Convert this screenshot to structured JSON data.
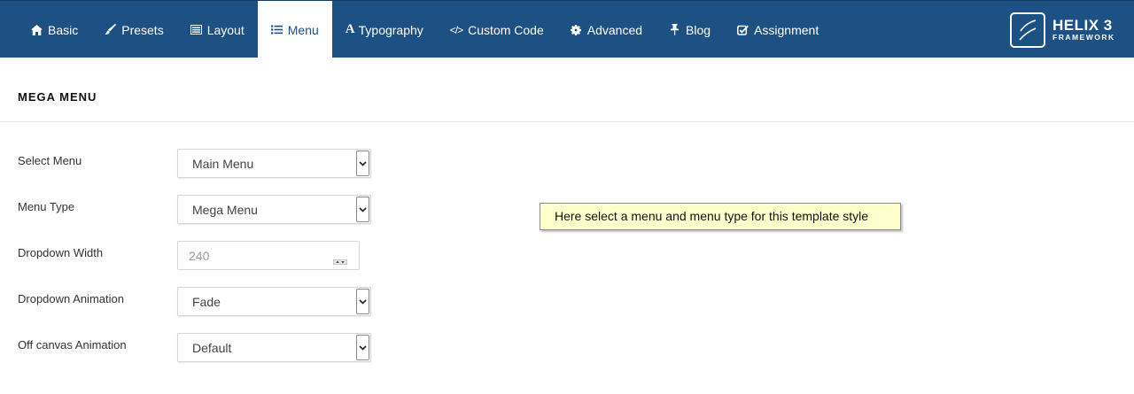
{
  "tabs": [
    {
      "label": "Basic",
      "icon": "home-icon"
    },
    {
      "label": "Presets",
      "icon": "brush-icon"
    },
    {
      "label": "Layout",
      "icon": "layout-icon"
    },
    {
      "label": "Menu",
      "icon": "list-icon",
      "active": true
    },
    {
      "label": "Typography",
      "icon": "font-icon"
    },
    {
      "label": "Custom Code",
      "icon": "code-icon"
    },
    {
      "label": "Advanced",
      "icon": "gear-icon"
    },
    {
      "label": "Blog",
      "icon": "pin-icon"
    },
    {
      "label": "Assignment",
      "icon": "checkbox-icon"
    }
  ],
  "logo": {
    "title": "HELIX 3",
    "subtitle": "FRAMEWORK"
  },
  "section": {
    "title": "MEGA MENU"
  },
  "fields": [
    {
      "label": "Select Menu",
      "value": "Main Menu"
    },
    {
      "label": "Menu Type",
      "value": "Mega Menu"
    },
    {
      "label": "Dropdown Width",
      "value": "240"
    },
    {
      "label": "Dropdown Animation",
      "value": "Fade"
    },
    {
      "label": "Off canvas Animation",
      "value": "Default"
    }
  ],
  "tooltip": {
    "text": "Here select a menu and menu type for this template style"
  },
  "colors": {
    "header_bg": "#1d5083",
    "tooltip_bg": "#ffffcc"
  }
}
